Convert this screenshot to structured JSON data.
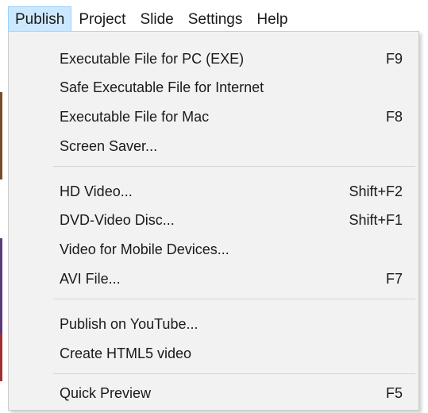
{
  "menubar": {
    "items": [
      {
        "label": "Publish",
        "active": true
      },
      {
        "label": "Project",
        "active": false
      },
      {
        "label": "Slide",
        "active": false
      },
      {
        "label": "Settings",
        "active": false
      },
      {
        "label": "Help",
        "active": false
      }
    ]
  },
  "publish_menu": {
    "groups": [
      {
        "items": [
          {
            "label": "Executable File for PC (EXE)",
            "shortcut": "F9"
          },
          {
            "label": "Safe Executable File for Internet",
            "shortcut": ""
          },
          {
            "label": "Executable File for Mac",
            "shortcut": "F8"
          },
          {
            "label": "Screen Saver...",
            "shortcut": ""
          }
        ]
      },
      {
        "items": [
          {
            "label": "HD Video...",
            "shortcut": "Shift+F2"
          },
          {
            "label": "DVD-Video Disc...",
            "shortcut": "Shift+F1"
          },
          {
            "label": "Video for Mobile Devices...",
            "shortcut": ""
          },
          {
            "label": "AVI File...",
            "shortcut": "F7"
          }
        ]
      },
      {
        "items": [
          {
            "label": "Publish on YouTube...",
            "shortcut": ""
          },
          {
            "label": "Create HTML5 video",
            "shortcut": ""
          }
        ]
      },
      {
        "items": [
          {
            "label": "Quick Preview",
            "shortcut": "F5"
          }
        ]
      }
    ]
  },
  "colors": {
    "menu_background": "#f2f2f2",
    "active_menubar_background": "#cce8ff",
    "active_menubar_border": "#99d1ff",
    "separator": "#d7d7d7"
  }
}
